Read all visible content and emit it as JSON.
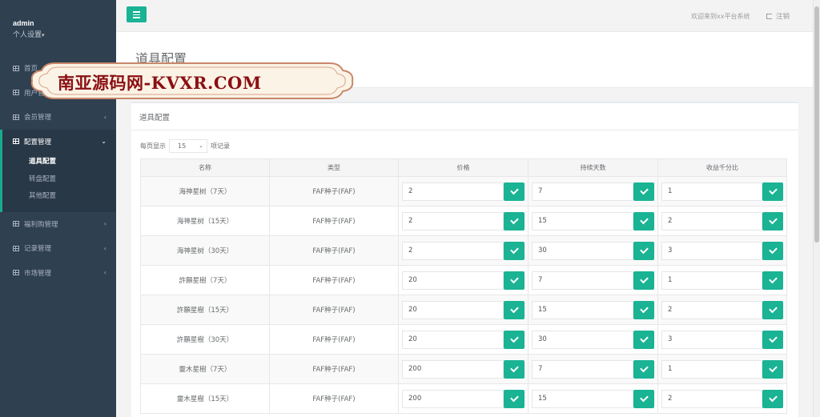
{
  "sidebar": {
    "username": "admin",
    "settings_label": "个人设置",
    "items_before": [
      {
        "label": "首页",
        "arrow": ""
      },
      {
        "label": "用户管理",
        "arrow": ""
      },
      {
        "label": "会员管理",
        "arrow": "‹"
      }
    ],
    "active_item": {
      "label": "配置管理",
      "arrow": "⌄"
    },
    "subitems": [
      {
        "label": "道具配置",
        "active": true
      },
      {
        "label": "转盘配置",
        "active": false
      },
      {
        "label": "其他配置",
        "active": false
      }
    ],
    "items_after": [
      {
        "label": "福利购管理",
        "arrow": "‹"
      },
      {
        "label": "记录管理",
        "arrow": "‹"
      },
      {
        "label": "市场管理",
        "arrow": "‹"
      }
    ]
  },
  "topbar": {
    "welcome": "欢迎来到xx平台系统",
    "logout": "注销"
  },
  "page": {
    "heading": "道具配置",
    "panel_title": "道具配置",
    "length_prefix": "每页显示",
    "length_value": "15",
    "length_suffix": "项记录"
  },
  "table": {
    "columns": [
      "名称",
      "类型",
      "价格",
      "持续天数",
      "收益千分比"
    ],
    "rows": [
      {
        "name": "海神星树（7天）",
        "type": "FAF种子(FAF)",
        "price": "2",
        "days": "7",
        "ratio": "1"
      },
      {
        "name": "海神星树（15天）",
        "type": "FAF种子(FAF)",
        "price": "2",
        "days": "15",
        "ratio": "2"
      },
      {
        "name": "海神星树（30天）",
        "type": "FAF种子(FAF)",
        "price": "2",
        "days": "30",
        "ratio": "3"
      },
      {
        "name": "許願星樹（7天）",
        "type": "FAF种子(FAF)",
        "price": "20",
        "days": "7",
        "ratio": "1"
      },
      {
        "name": "許願星樹（15天）",
        "type": "FAF种子(FAF)",
        "price": "20",
        "days": "15",
        "ratio": "2"
      },
      {
        "name": "許願星樹（30天）",
        "type": "FAF种子(FAF)",
        "price": "20",
        "days": "30",
        "ratio": "3"
      },
      {
        "name": "靈木星樹（7天）",
        "type": "FAF种子(FAF)",
        "price": "200",
        "days": "7",
        "ratio": "1"
      },
      {
        "name": "靈木星樹（15天）",
        "type": "FAF种子(FAF)",
        "price": "200",
        "days": "15",
        "ratio": "2"
      }
    ]
  },
  "watermark": {
    "text": "南亚源码网-KVXR.COM"
  },
  "colors": {
    "accent": "#1ab394",
    "sidebar": "#2f4050"
  }
}
